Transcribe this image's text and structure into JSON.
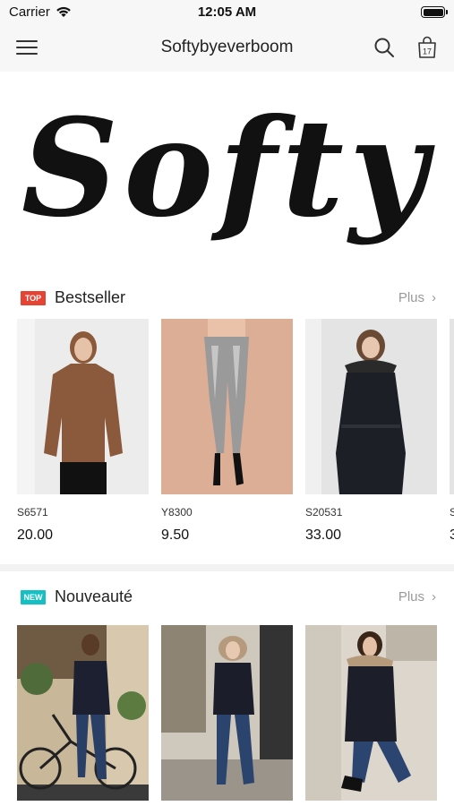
{
  "status_bar": {
    "carrier": "Carrier",
    "time": "12:05 AM"
  },
  "nav": {
    "title": "Softybyeverboom",
    "cart_count": "17"
  },
  "banner": {
    "logo_text": "Softy"
  },
  "bestseller": {
    "badge": "TOP",
    "title": "Bestseller",
    "more": "Plus",
    "products": [
      {
        "code": "S6571",
        "price": "20.00"
      },
      {
        "code": "Y8300",
        "price": "9.50"
      },
      {
        "code": "S20531",
        "price": "33.00"
      },
      {
        "code": "S",
        "price": "3"
      }
    ]
  },
  "new_arrivals": {
    "badge": "NEW",
    "title": "Nouveauté",
    "more": "Plus"
  },
  "colors": {
    "top_badge": "#e54435",
    "new_badge": "#15c0c4",
    "bar_bg": "#f7f7f7"
  }
}
